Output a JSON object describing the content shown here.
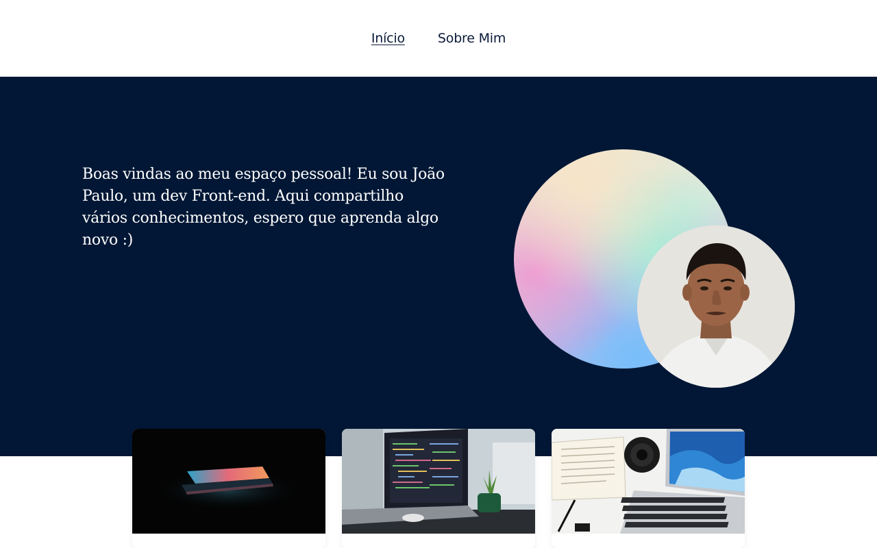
{
  "nav": {
    "items": [
      {
        "label": "Início",
        "active": true
      },
      {
        "label": "Sobre Mim",
        "active": false
      }
    ]
  },
  "hero": {
    "intro": "Boas vindas ao meu espaço pessoal! Eu sou João Paulo, um dev Front-end. Aqui compartilho vários conhecimentos, espero que aprenda algo novo :)"
  },
  "cards": [
    {
      "image": "laptop-glow-dark-photo"
    },
    {
      "image": "laptop-code-desk-photo"
    },
    {
      "image": "laptop-notebook-camera-photo"
    }
  ],
  "colors": {
    "hero_background": "#011735",
    "nav_text": "#0a1a38"
  }
}
